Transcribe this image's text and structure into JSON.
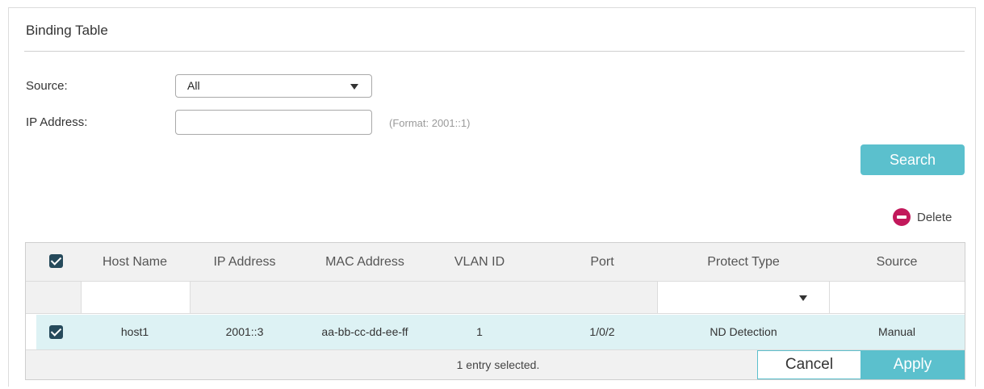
{
  "panel": {
    "title": "Binding Table"
  },
  "form": {
    "source_label": "Source:",
    "source_value": "All",
    "ip_label": "IP Address:",
    "ip_value": "",
    "ip_hint": "(Format: 2001::1)",
    "search_label": "Search"
  },
  "actions": {
    "delete_label": "Delete"
  },
  "table": {
    "columns": [
      "Host Name",
      "IP Address",
      "MAC Address",
      "VLAN ID",
      "Port",
      "Protect Type",
      "Source"
    ],
    "header_checked": true,
    "rows": [
      {
        "checked": true,
        "host_name": "host1",
        "ip_address": "2001::3",
        "mac_address": "aa-bb-cc-dd-ee-ff",
        "vlan_id": "1",
        "port": "1/0/2",
        "protect_type": "ND Detection",
        "source": "Manual"
      }
    ],
    "footer_text": "1 entry selected.",
    "cancel_label": "Cancel",
    "apply_label": "Apply"
  },
  "colors": {
    "accent": "#5bc0cd",
    "delete": "#c2185b",
    "checkbox": "#264a5b",
    "selected_row": "#ddf2f4"
  },
  "icons": {
    "delete": "minus-circle-icon",
    "dropdown": "caret-down-icon",
    "check": "checkmark-icon"
  }
}
